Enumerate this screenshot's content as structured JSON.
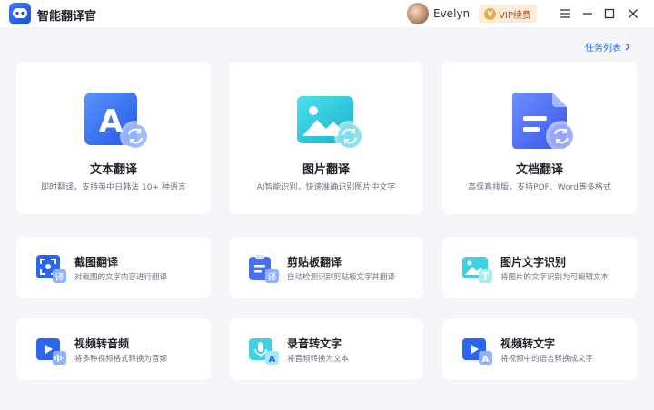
{
  "app": {
    "title": "智能翻译官"
  },
  "user": {
    "name": "Evelyn"
  },
  "vip": {
    "label": "VIP续费",
    "badge": "V"
  },
  "task_link": {
    "label": "任务列表"
  },
  "big_cards": [
    {
      "title": "文本翻译",
      "desc": "即时翻译，支持英中日韩法 10+ 种语言",
      "icon": "text-translate-icon"
    },
    {
      "title": "图片翻译",
      "desc": "AI智能识别，快速准确识别图片中文字",
      "icon": "image-translate-icon"
    },
    {
      "title": "文档翻译",
      "desc": "高保真排版，支持PDF、Word等多格式",
      "icon": "document-translate-icon"
    }
  ],
  "small_cards": [
    {
      "title": "截图翻译",
      "desc": "对截图的文字内容进行翻译",
      "icon": "screenshot-translate-icon",
      "badge": "译"
    },
    {
      "title": "剪贴板翻译",
      "desc": "自动检测识别剪贴板文字并翻译",
      "icon": "clipboard-translate-icon",
      "badge": "译"
    },
    {
      "title": "图片文字识别",
      "desc": "将图片的文字识别为可编辑文本",
      "icon": "image-ocr-icon"
    },
    {
      "title": "视频转音频",
      "desc": "将多种视频格式转换为音频",
      "icon": "video-to-audio-icon"
    },
    {
      "title": "录音转文字",
      "desc": "将音频转换为文本",
      "icon": "audio-to-text-icon",
      "badge": "A"
    },
    {
      "title": "视频转文字",
      "desc": "将视频中的语言转换成文字",
      "icon": "video-to-text-icon",
      "badge": "A"
    }
  ],
  "colors": {
    "primary": "#2b66f0",
    "teal": "#2cc4d8",
    "background": "#f3f5f9"
  }
}
